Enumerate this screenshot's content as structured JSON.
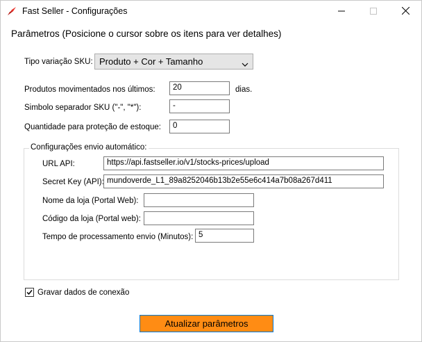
{
  "window": {
    "title": "Fast Seller - Configurações",
    "icon": "fastseller-logo-icon",
    "controls": [
      "minimize-icon",
      "maximize-icon",
      "close-icon"
    ]
  },
  "heading": "Parâmetros (Posicione o cursor sobre os itens para ver detalhes)",
  "sku": {
    "label": "Tipo variação SKU:",
    "selected": "Produto + Cor + Tamanho"
  },
  "moved_products": {
    "label": "Produtos movimentados nos últimos:",
    "value": "20",
    "suffix": "dias."
  },
  "separator": {
    "label": "Simbolo separador SKU (\"-\", \"*\"):",
    "value": "-"
  },
  "protection_qty": {
    "label": "Quantidade para proteção de estoque:",
    "value": "0"
  },
  "auto_send": {
    "legend": "Configurações envio automático:",
    "url_label": "URL API:",
    "url_value": "https://api.fastseller.io/v1/stocks-prices/upload",
    "secret_label": "Secret Key (API):",
    "secret_value": "mundoverde_L1_89a8252046b13b2e55e6c414a7b08a267d411",
    "store_name_label": "Nome da loja (Portal Web):",
    "store_name_value": "",
    "store_code_label": "Código da loja (Portal web):",
    "store_code_value": "",
    "time_label": "Tempo de processamento envio (Minutos):",
    "time_value": "5"
  },
  "save_connection": {
    "label": "Gravar dados de conexão",
    "checked": true
  },
  "submit_button": "Atualizar parâmetros",
  "colors": {
    "button_bg": "#ff8c14",
    "button_border": "#0078d7",
    "combo_bg": "#e5e5e5",
    "logo_red": "#e8312a"
  }
}
